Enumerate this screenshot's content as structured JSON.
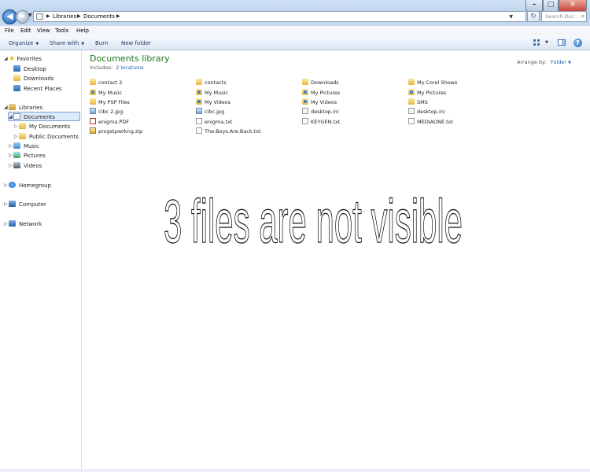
{
  "window": {
    "min_glyph": "–",
    "max_glyph": "□",
    "close_glyph": "✕"
  },
  "address": {
    "crumbs": [
      "Libraries",
      "Documents"
    ],
    "search_placeholder": "Search Doc..."
  },
  "menu": [
    "File",
    "Edit",
    "View",
    "Tools",
    "Help"
  ],
  "toolbar": {
    "organize": "Organize",
    "share_with": "Share with",
    "burn": "Burn",
    "new_folder": "New folder"
  },
  "nav": {
    "favorites": "Favorites",
    "desktop": "Desktop",
    "downloads": "Downloads",
    "recent_places": "Recent Places",
    "libraries": "Libraries",
    "documents": "Documents",
    "my_documents": "My Documents",
    "public_documents": "Public Documents",
    "music": "Music",
    "pictures": "Pictures",
    "videos": "Videos",
    "homegroup": "Homegroup",
    "computer": "Computer",
    "network": "Network"
  },
  "library": {
    "title": "Documents library",
    "includes_label": "Includes:",
    "includes_link": "2 locations",
    "arrange_label": "Arrange by:",
    "arrange_value": "Folder"
  },
  "files": [
    {
      "name": "contact 2",
      "type": "folder"
    },
    {
      "name": "My Music",
      "type": "special"
    },
    {
      "name": "My PSP Files",
      "type": "folder"
    },
    {
      "name": "cibc 2.jpg",
      "type": "jpg"
    },
    {
      "name": "enigma.PDF",
      "type": "pdf"
    },
    {
      "name": "progstpwrkng.zip",
      "type": "zip"
    },
    {
      "name": "contacts",
      "type": "folder"
    },
    {
      "name": "My Music",
      "type": "special"
    },
    {
      "name": "My Videos",
      "type": "special"
    },
    {
      "name": "cibc.jpg",
      "type": "jpg"
    },
    {
      "name": "enigma.txt",
      "type": "txt"
    },
    {
      "name": "The.Boys.Are.Back.txt",
      "type": "txt"
    },
    {
      "name": "Downloads",
      "type": "folder"
    },
    {
      "name": "My Pictures",
      "type": "special"
    },
    {
      "name": "My Videos",
      "type": "special"
    },
    {
      "name": "desktop.ini",
      "type": "ini"
    },
    {
      "name": "KEYGEN.txt",
      "type": "txt"
    },
    {
      "name": "My Corel Shows",
      "type": "folder"
    },
    {
      "name": "My Pictures",
      "type": "special"
    },
    {
      "name": "SMS",
      "type": "folder"
    },
    {
      "name": "desktop.ini",
      "type": "ini"
    },
    {
      "name": "MEDIAONE.txt",
      "type": "txt"
    }
  ],
  "annotation": "3 files are not visible"
}
